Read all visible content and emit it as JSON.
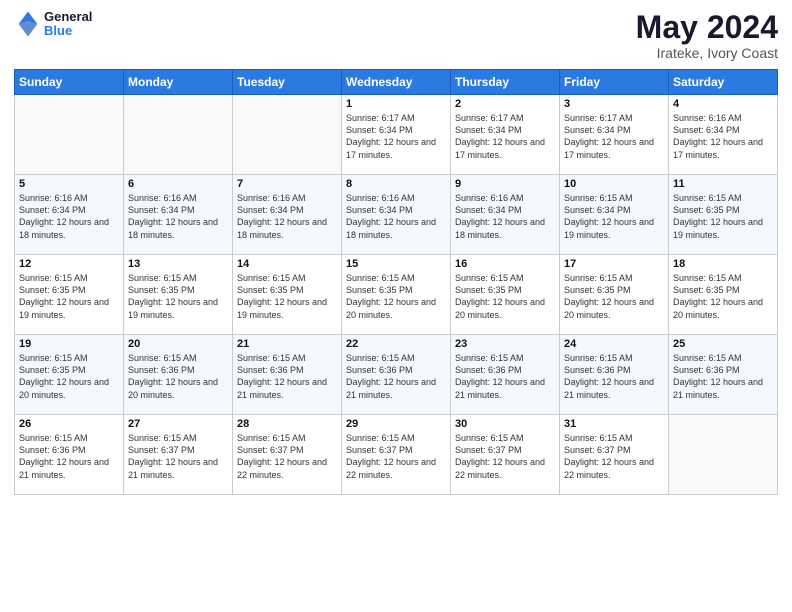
{
  "header": {
    "logo_line1": "General",
    "logo_line2": "Blue",
    "month_title": "May 2024",
    "location": "Irateke, Ivory Coast"
  },
  "days_of_week": [
    "Sunday",
    "Monday",
    "Tuesday",
    "Wednesday",
    "Thursday",
    "Friday",
    "Saturday"
  ],
  "weeks": [
    [
      {
        "day": "",
        "info": ""
      },
      {
        "day": "",
        "info": ""
      },
      {
        "day": "",
        "info": ""
      },
      {
        "day": "1",
        "info": "Sunrise: 6:17 AM\nSunset: 6:34 PM\nDaylight: 12 hours and 17 minutes."
      },
      {
        "day": "2",
        "info": "Sunrise: 6:17 AM\nSunset: 6:34 PM\nDaylight: 12 hours and 17 minutes."
      },
      {
        "day": "3",
        "info": "Sunrise: 6:17 AM\nSunset: 6:34 PM\nDaylight: 12 hours and 17 minutes."
      },
      {
        "day": "4",
        "info": "Sunrise: 6:16 AM\nSunset: 6:34 PM\nDaylight: 12 hours and 17 minutes."
      }
    ],
    [
      {
        "day": "5",
        "info": "Sunrise: 6:16 AM\nSunset: 6:34 PM\nDaylight: 12 hours and 18 minutes."
      },
      {
        "day": "6",
        "info": "Sunrise: 6:16 AM\nSunset: 6:34 PM\nDaylight: 12 hours and 18 minutes."
      },
      {
        "day": "7",
        "info": "Sunrise: 6:16 AM\nSunset: 6:34 PM\nDaylight: 12 hours and 18 minutes."
      },
      {
        "day": "8",
        "info": "Sunrise: 6:16 AM\nSunset: 6:34 PM\nDaylight: 12 hours and 18 minutes."
      },
      {
        "day": "9",
        "info": "Sunrise: 6:16 AM\nSunset: 6:34 PM\nDaylight: 12 hours and 18 minutes."
      },
      {
        "day": "10",
        "info": "Sunrise: 6:15 AM\nSunset: 6:34 PM\nDaylight: 12 hours and 19 minutes."
      },
      {
        "day": "11",
        "info": "Sunrise: 6:15 AM\nSunset: 6:35 PM\nDaylight: 12 hours and 19 minutes."
      }
    ],
    [
      {
        "day": "12",
        "info": "Sunrise: 6:15 AM\nSunset: 6:35 PM\nDaylight: 12 hours and 19 minutes."
      },
      {
        "day": "13",
        "info": "Sunrise: 6:15 AM\nSunset: 6:35 PM\nDaylight: 12 hours and 19 minutes."
      },
      {
        "day": "14",
        "info": "Sunrise: 6:15 AM\nSunset: 6:35 PM\nDaylight: 12 hours and 19 minutes."
      },
      {
        "day": "15",
        "info": "Sunrise: 6:15 AM\nSunset: 6:35 PM\nDaylight: 12 hours and 20 minutes."
      },
      {
        "day": "16",
        "info": "Sunrise: 6:15 AM\nSunset: 6:35 PM\nDaylight: 12 hours and 20 minutes."
      },
      {
        "day": "17",
        "info": "Sunrise: 6:15 AM\nSunset: 6:35 PM\nDaylight: 12 hours and 20 minutes."
      },
      {
        "day": "18",
        "info": "Sunrise: 6:15 AM\nSunset: 6:35 PM\nDaylight: 12 hours and 20 minutes."
      }
    ],
    [
      {
        "day": "19",
        "info": "Sunrise: 6:15 AM\nSunset: 6:35 PM\nDaylight: 12 hours and 20 minutes."
      },
      {
        "day": "20",
        "info": "Sunrise: 6:15 AM\nSunset: 6:36 PM\nDaylight: 12 hours and 20 minutes."
      },
      {
        "day": "21",
        "info": "Sunrise: 6:15 AM\nSunset: 6:36 PM\nDaylight: 12 hours and 21 minutes."
      },
      {
        "day": "22",
        "info": "Sunrise: 6:15 AM\nSunset: 6:36 PM\nDaylight: 12 hours and 21 minutes."
      },
      {
        "day": "23",
        "info": "Sunrise: 6:15 AM\nSunset: 6:36 PM\nDaylight: 12 hours and 21 minutes."
      },
      {
        "day": "24",
        "info": "Sunrise: 6:15 AM\nSunset: 6:36 PM\nDaylight: 12 hours and 21 minutes."
      },
      {
        "day": "25",
        "info": "Sunrise: 6:15 AM\nSunset: 6:36 PM\nDaylight: 12 hours and 21 minutes."
      }
    ],
    [
      {
        "day": "26",
        "info": "Sunrise: 6:15 AM\nSunset: 6:36 PM\nDaylight: 12 hours and 21 minutes."
      },
      {
        "day": "27",
        "info": "Sunrise: 6:15 AM\nSunset: 6:37 PM\nDaylight: 12 hours and 21 minutes."
      },
      {
        "day": "28",
        "info": "Sunrise: 6:15 AM\nSunset: 6:37 PM\nDaylight: 12 hours and 22 minutes."
      },
      {
        "day": "29",
        "info": "Sunrise: 6:15 AM\nSunset: 6:37 PM\nDaylight: 12 hours and 22 minutes."
      },
      {
        "day": "30",
        "info": "Sunrise: 6:15 AM\nSunset: 6:37 PM\nDaylight: 12 hours and 22 minutes."
      },
      {
        "day": "31",
        "info": "Sunrise: 6:15 AM\nSunset: 6:37 PM\nDaylight: 12 hours and 22 minutes."
      },
      {
        "day": "",
        "info": ""
      }
    ]
  ]
}
